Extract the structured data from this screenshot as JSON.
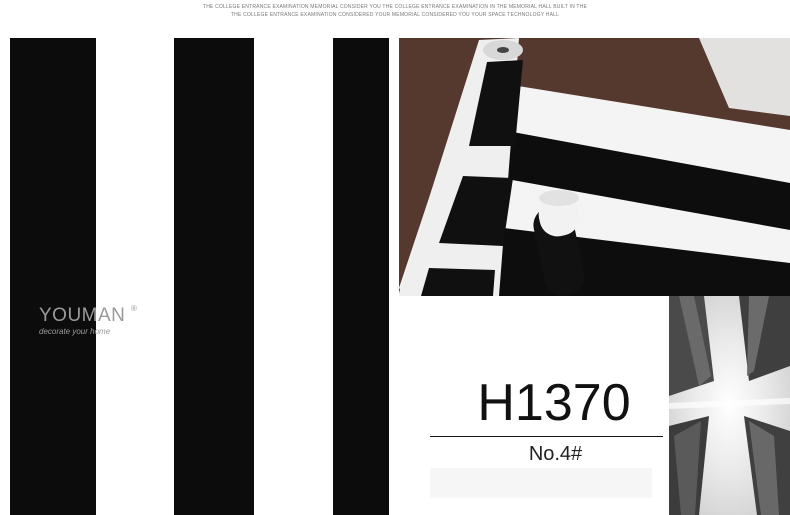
{
  "header": {
    "line1": "THE COLLEGE ENTRANCE EXAMINATION MEMORIAL CONSIDER YOU THE COLLEGE ENTRANCE EXAMINATION IN THE MEMORIAL HALL BUILT IN THE",
    "line2": "THE COLLEGE ENTRANCE EXAMINATION CONSIDERED YOUR MEMORIAL CONSIDERED YOU YOUR SPACE TECHNOLOGY HALL"
  },
  "brand": {
    "name": "YOUMAN",
    "registered": "®",
    "tagline": "decorate your home"
  },
  "product": {
    "code": "H1370",
    "number": "No.4#"
  },
  "colors": {
    "stripe_dark": "#0c0c0c",
    "stripe_light": "#ffffff",
    "carpet": "#5a3d32"
  }
}
